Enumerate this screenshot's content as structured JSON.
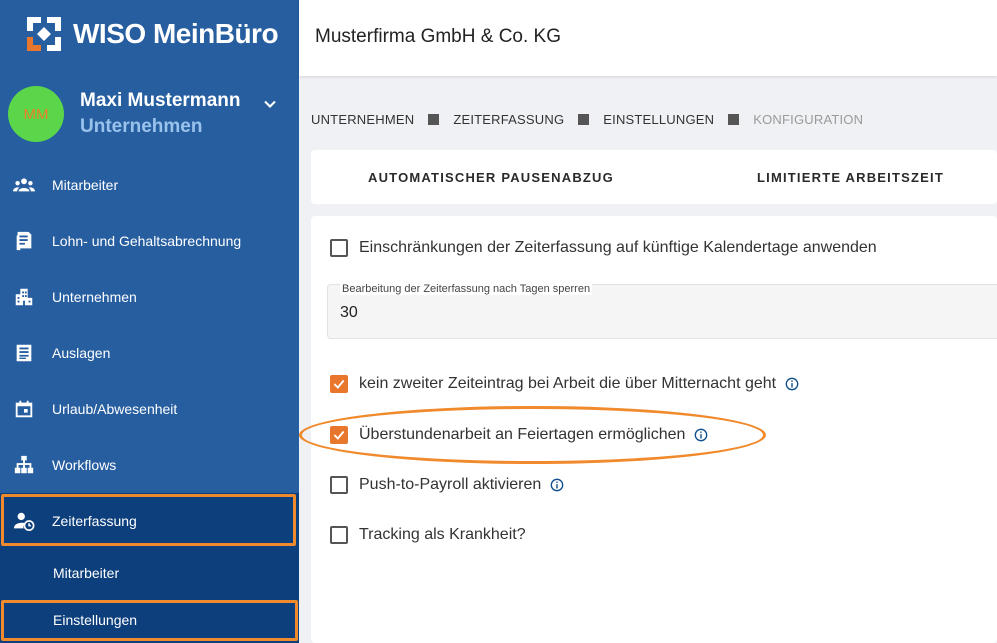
{
  "app": {
    "logo_text": "WISO MeinBüro"
  },
  "user": {
    "initials": "MM",
    "name": "Maxi Mustermann",
    "role": "Unternehmen"
  },
  "sidebar": {
    "items": [
      {
        "label": "Mitarbeiter",
        "icon": "people-icon"
      },
      {
        "label": "Lohn- und Gehaltsabrechnung",
        "icon": "payroll-document-icon"
      },
      {
        "label": "Unternehmen",
        "icon": "building-icon"
      },
      {
        "label": "Auslagen",
        "icon": "receipt-icon"
      },
      {
        "label": "Urlaub/Abwesenheit",
        "icon": "calendar-icon"
      },
      {
        "label": "Workflows",
        "icon": "sitemap-icon"
      },
      {
        "label": "Zeiterfassung",
        "icon": "user-clock-icon",
        "active": true
      }
    ],
    "subitems": [
      {
        "label": "Mitarbeiter"
      },
      {
        "label": "Einstellungen",
        "active": true
      }
    ]
  },
  "header": {
    "company": "Musterfirma GmbH & Co. KG"
  },
  "breadcrumb": [
    "UNTERNEHMEN",
    "ZEITERFASSUNG",
    "EINSTELLUNGEN",
    "KONFIGURATION"
  ],
  "tabs": [
    "AUTOMATISCHER PAUSENABZUG",
    "LIMITIERTE ARBEITSZEIT"
  ],
  "settings": {
    "restrict_future_label": "Einschränkungen der Zeiterfassung auf künftige Kalendertage anwenden",
    "restrict_future_checked": false,
    "lock_days_label": "Bearbeitung der Zeiterfassung nach Tagen sperren",
    "lock_days_value": "30",
    "midnight_label": "kein zweiter Zeiteintrag bei Arbeit die über Mitternacht geht",
    "midnight_checked": true,
    "holiday_overtime_label": "Überstundenarbeit an Feiertagen ermöglichen",
    "holiday_overtime_checked": true,
    "push_payroll_label": "Push-to-Payroll aktivieren",
    "push_payroll_checked": false,
    "sick_tracking_label": "Tracking als Krankheit?",
    "sick_tracking_checked": false
  },
  "colors": {
    "sidebar": "#265ea0",
    "sidebar_active": "#0d3f7c",
    "accent": "#e8762c",
    "highlight": "#f08a2c",
    "role_text": "#9ac3ec",
    "avatar": "#5bd64a"
  }
}
